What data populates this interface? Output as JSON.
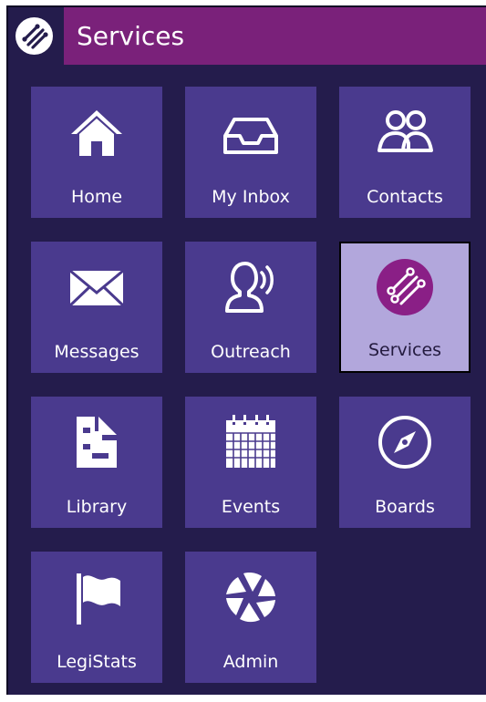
{
  "header": {
    "title": "Services",
    "logo_icon": "services-swirl-logo"
  },
  "colors": {
    "panel": "#241c4c",
    "title_bar": "#7a217a",
    "tile": "#4a3a8e",
    "tile_selected": "#b2a7dc",
    "selected_badge": "#8a1f86"
  },
  "tiles": [
    {
      "label": "Home",
      "icon": "home-icon"
    },
    {
      "label": "My Inbox",
      "icon": "inbox-tray-icon"
    },
    {
      "label": "Contacts",
      "icon": "contacts-people-icon"
    },
    {
      "label": "Messages",
      "icon": "envelope-icon"
    },
    {
      "label": "Outreach",
      "icon": "speaking-person-icon"
    },
    {
      "label": "Services",
      "icon": "services-swirl-icon",
      "selected": true
    },
    {
      "label": "Library",
      "icon": "library-document-icon"
    },
    {
      "label": "Events",
      "icon": "calendar-icon"
    },
    {
      "label": "Boards",
      "icon": "compass-icon"
    },
    {
      "label": "LegiStats",
      "icon": "flag-icon"
    },
    {
      "label": "Admin",
      "icon": "aperture-icon"
    }
  ]
}
